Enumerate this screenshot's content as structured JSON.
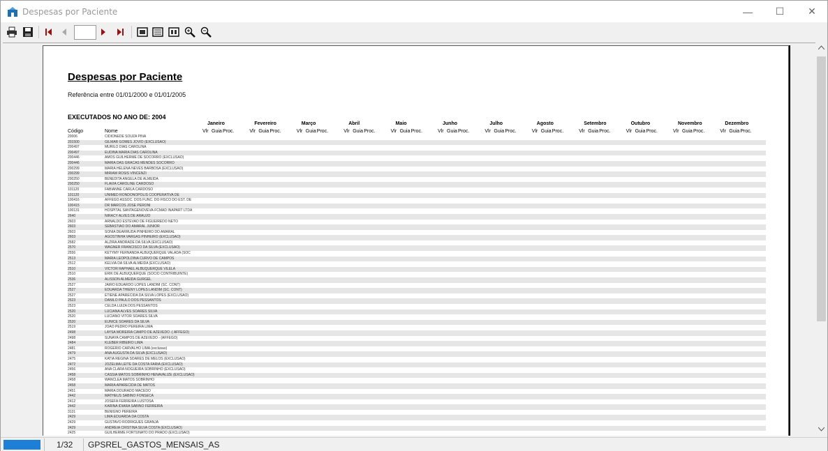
{
  "window": {
    "title": "Despesas por Paciente",
    "minimize": "—",
    "maximize": "☐",
    "close": "✕"
  },
  "toolbar": {
    "icons": [
      "printer-icon",
      "save-icon",
      "first-page-icon",
      "prev-page-icon",
      "next-page-icon",
      "last-page-icon",
      "page-width-icon",
      "whole-page-icon",
      "two-pages-icon",
      "zoom-in-icon",
      "zoom-out-icon"
    ],
    "page_value": ""
  },
  "report": {
    "title": "Despesas por Paciente",
    "reference": "Referência entre 01/01/2000 e 01/01/2005",
    "section": "EXECUTADOS NO ANO DE: 2004",
    "months": [
      "Janeiro",
      "Fevereiro",
      "Março",
      "Abril",
      "Maio",
      "Junho",
      "Julho",
      "Agosto",
      "Setembro",
      "Outubro",
      "Novembro",
      "Dezembro"
    ],
    "col_codigo": "Código",
    "col_nome": "Nome",
    "col_guia": "Guia",
    "col_proc": "Proc.",
    "col_vlr": "Vlr",
    "rows": [
      {
        "code": "20006",
        "name": "CIDIONEDE SOUZA PINA"
      },
      {
        "code": "201500",
        "name": "GILMAR GOMES JOVIO (EXCLUSAO)"
      },
      {
        "code": "200497",
        "name": "MURILO DIAS CAROLINA"
      },
      {
        "code": "200497",
        "name": "EUDINA MARIA DIAS CAROLINA"
      },
      {
        "code": "200446",
        "name": "AMOS GUILHERME DE SOCORRO (EXCLUSAO)"
      },
      {
        "code": "200446",
        "name": "MARIA DAS GRACAS MENDES SOCORRO"
      },
      {
        "code": "200299",
        "name": "MARIA HELENA NEVES BARBOSA (EXCLUSAO)"
      },
      {
        "code": "200299",
        "name": "MIRIAM ROSIS VINCENZI"
      },
      {
        "code": "200250",
        "name": "BENEDITA ANGELA DE ALMEIDA"
      },
      {
        "code": "200250",
        "name": "FLAVIA CAROLINE CARDOSO"
      },
      {
        "code": "101120",
        "name": "FABIANNE CARLA CARDOSO"
      },
      {
        "code": "101120",
        "name": "UNIMED RONDONOPOLIS COOPERATIVA DE"
      },
      {
        "code": "100416",
        "name": "AFFEGO ASSOC. DOS FUNC. DO FISCO DO EST. DE"
      },
      {
        "code": "100415",
        "name": "DR MARCOS JOSE PERONI"
      },
      {
        "code": "100131",
        "name": "HOSPITAL SANTAGENOVEVA-FCMAD INAPART LTDA"
      },
      {
        "code": "2640",
        "name": "NIRACY ALVES DE ARAUJO"
      },
      {
        "code": "2603",
        "name": "ARNALDO ESTEVAO DE FIGUEIREDO NETO"
      },
      {
        "code": "2603",
        "name": "SEBASTIAO DO AMARAL JUNIOR"
      },
      {
        "code": "2603",
        "name": "SONIA DEARRUDA PINHEIRO DO AMARAL"
      },
      {
        "code": "2603",
        "name": "AGOSTINHA VARGAS PINHEIRO (EXCLUSAO)"
      },
      {
        "code": "2582",
        "name": "ALZIRA ANDRADE DA SILVA (EXCLUSAO)"
      },
      {
        "code": "2570",
        "name": "WAGNER FRANCISCO DA SILVA (EXCLUSAO)"
      },
      {
        "code": "2556",
        "name": "KETYMY FERNANDA ALBUQUERQUE VALADA (SOC"
      },
      {
        "code": "2513",
        "name": "MARIA LEOPOLDINA CURVO DE CAMPOS"
      },
      {
        "code": "2512",
        "name": "KELVIA DA SILVA ALMEIDA (EXCLUSAO)"
      },
      {
        "code": "2510",
        "name": "VICTOR RAPHAEL ALBUQUERQUE VILELA"
      },
      {
        "code": "2510",
        "name": "ERIK DE ALBUQUERQUE (SOCIO CONTRIBUINTE)"
      },
      {
        "code": "2536",
        "name": "ALISSON ALMEIDA GURGEL"
      },
      {
        "code": "2527",
        "name": "JAIRO EDUARDO LOPES LANDIM (SC. CONT)"
      },
      {
        "code": "2527",
        "name": "EDUARDA THIENY LOPES LANDIM (SC. CONT)"
      },
      {
        "code": "2527",
        "name": "ETIENE APARECIDA DA SILVA LOPES (EXCLUSAO)"
      },
      {
        "code": "2523",
        "name": "DANILO PAULO DOS PESSANTOS"
      },
      {
        "code": "2523",
        "name": "CELDA LUIZA DOS PESSANTOS"
      },
      {
        "code": "2520",
        "name": "LUCIANA ALVES SOARES SILVA"
      },
      {
        "code": "2520",
        "name": "LUCIANO VITOR SOARES SILVA"
      },
      {
        "code": "2520",
        "name": "EUNICE SOARES DA SILVA"
      },
      {
        "code": "2519",
        "name": "JOAO PEDRO PEREIRA LIMA"
      },
      {
        "code": "2498",
        "name": "LAYSA MOREIRA CAMPO DE AZEVEDO -( AFFEGO)"
      },
      {
        "code": "2498",
        "name": "SUNAYA CAMPOS DE AZEVEDO - (AFFEGO)"
      },
      {
        "code": "2484",
        "name": "KLEBER RIBEIRO LIMA"
      },
      {
        "code": "2481",
        "name": "ROGERIO CARVALHO LIMA (exclusao)"
      },
      {
        "code": "2479",
        "name": "ANA AUGUSTA DA SILVA (EXCLUSAO)"
      },
      {
        "code": "2475",
        "name": "KATIA REGINA SOARES DE MELOS (EXCLUSAO)"
      },
      {
        "code": "2472",
        "name": "JOZELMA LEITE DA COSTA FARIA (EXCLUSAO)"
      },
      {
        "code": "2456",
        "name": "ANA CLARA NOGUEIRA SOBRINHO (EXCLUSAO)"
      },
      {
        "code": "2458",
        "name": "CASSIA MATOS SOBRINHO HENAVALIZE (EXCLUSAO)"
      },
      {
        "code": "2458",
        "name": "WANCLEA MATOS SOBRINHO"
      },
      {
        "code": "2458",
        "name": "MARIA APARECIDA DE MATOS"
      },
      {
        "code": "2451",
        "name": "MARIA DOURADO MACEDO"
      },
      {
        "code": "2442",
        "name": "MATHEUS SABINO FONSECA"
      },
      {
        "code": "2412",
        "name": "JOSEFA FERREIRA LUSTOSA"
      },
      {
        "code": "2442",
        "name": "KARINA IDIARA SABINO FERREIRA"
      },
      {
        "code": "3131",
        "name": "BENIGNO PEREIRA"
      },
      {
        "code": "2429",
        "name": "LIMA EDUARDA DA COSTA"
      },
      {
        "code": "2429",
        "name": "GUSTAVO RODRIGUES GRANJA"
      },
      {
        "code": "2429",
        "name": "ANDREIA CRISTINA SILVA COSTA (EXCLUSAO)"
      },
      {
        "code": "2425",
        "name": "GUILHERME FORTUNATO DO PRADO (EXCLUSAO)"
      }
    ]
  },
  "status": {
    "page": "1/32",
    "report_name": "GPSREL_GASTOS_MENSAIS_AS"
  }
}
